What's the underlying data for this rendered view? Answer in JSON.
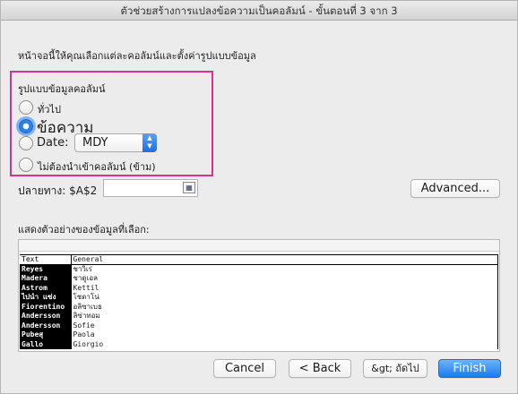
{
  "window": {
    "title": "ตัวช่วยสร้างการแปลงข้อความเป็นคอลัมน์ - ขั้นตอนที่ 3 จาก 3"
  },
  "instruction": "หน้าจอนี้ให้คุณเลือกแต่ละคอลัมน์และตั้งค่ารูปแบบข้อมูล",
  "column_format": {
    "label": "รูปแบบข้อมูลคอลัมน์",
    "options": [
      {
        "label": "ทั่วไป",
        "checked": false
      },
      {
        "label": "ข้อความ",
        "checked": true
      },
      {
        "label": "Date:",
        "checked": false
      },
      {
        "label": "ไม่ต้องนำเข้าคอลัมน์ (ข้าม)",
        "checked": false
      }
    ],
    "date_format": "MDY"
  },
  "destination": {
    "label": "ปลายทาง:",
    "value": "$A$2"
  },
  "advanced_button": "Advanced...",
  "preview": {
    "label": "แสดงตัวอย่างของข้อมูลที่เลือก:",
    "rows": [
      [
        "Text",
        "General"
      ],
      [
        "Reyes",
        "ชาวิเร่"
      ],
      [
        "Madera",
        "ชาดูเอล"
      ],
      [
        "Astrom",
        "Kettil"
      ],
      [
        "ไปนำ แซ่ง",
        "โชดาโน่"
      ],
      [
        "Fiorentino",
        "อลิซาเบธ"
      ],
      [
        "Andersson",
        "ลิซ่าทอม"
      ],
      [
        "Andersson",
        "Sofie"
      ],
      [
        "Pubeสุ",
        "Paola"
      ],
      [
        "Gallo",
        "Giorgio"
      ]
    ]
  },
  "buttons": {
    "cancel": "Cancel",
    "back": "< Back",
    "next": "&gt; ถัดไป",
    "finish": "Finish"
  }
}
